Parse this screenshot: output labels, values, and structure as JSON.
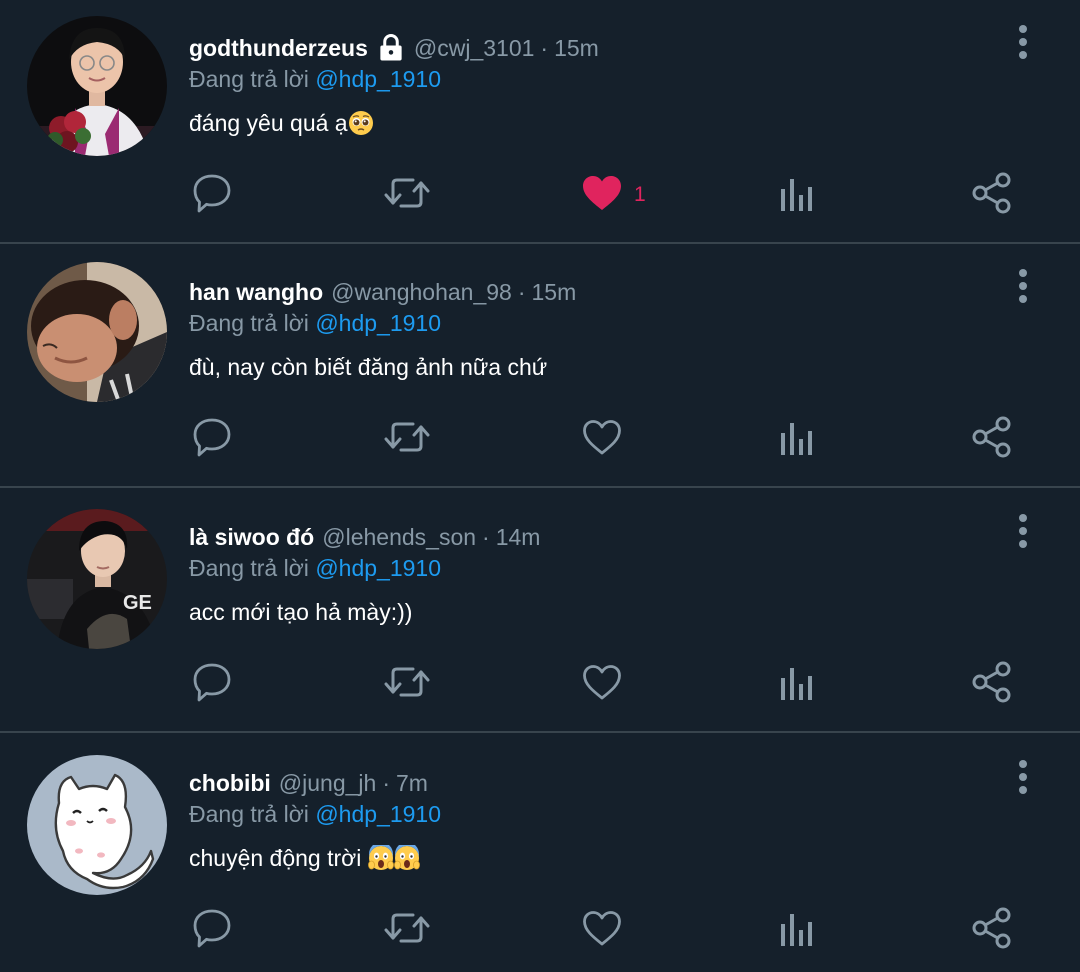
{
  "colors": {
    "background": "#15202b",
    "divider": "#38444d",
    "secondary_text": "#8899a6",
    "mention": "#1d9bf0",
    "liked": "#e0245e",
    "icon": "#8899a6"
  },
  "reply_prefix": "Đang trả lời",
  "tweets": [
    {
      "display_name": "godthunderzeus",
      "protected": true,
      "handle": "@cwj_3101",
      "separator": "·",
      "time": "15m",
      "reply_to": "@hdp_1910",
      "text": "đáng yêu quá ạ",
      "text_emoji": "pleading-face",
      "liked": true,
      "like_count": "1",
      "avatar": "young man with bouquet and medal"
    },
    {
      "display_name": "han wangho",
      "protected": false,
      "handle": "@wanghohan_98",
      "separator": "·",
      "time": "15m",
      "reply_to": "@hdp_1910",
      "text": "đù, nay còn biết đăng ảnh nữa chứ",
      "liked": false,
      "like_count": "",
      "avatar": "man looking down"
    },
    {
      "display_name": "là siwoo đó",
      "protected": false,
      "handle": "@lehends_son",
      "separator": "·",
      "time": "14m",
      "reply_to": "@hdp_1910",
      "text": "acc mới tạo hả mày:))",
      "liked": false,
      "like_count": "",
      "avatar": "man in black team jacket"
    },
    {
      "display_name": "chobibi",
      "protected": false,
      "handle": "@jung_jh",
      "separator": "·",
      "time": "7m",
      "reply_to": "@hdp_1910",
      "text": "chuyện động trời ",
      "text_emoji": "screaming-face",
      "liked": false,
      "like_count": "",
      "avatar": "white cartoon cat"
    }
  ]
}
